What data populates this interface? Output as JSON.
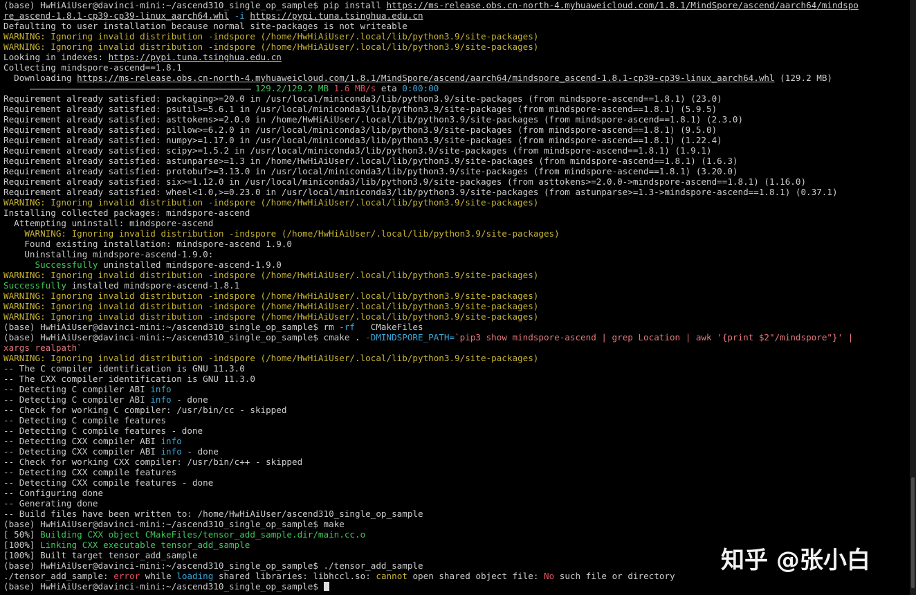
{
  "terminal": {
    "prompt": "(base) HwHiAiUser@davinci-mini:~/ascend310_single_op_sample$",
    "lines": [
      [
        {
          "t": "(base) HwHiAiUser@davinci-mini:~/ascend310_single_op_sample$ pip install ",
          "c": "default"
        },
        {
          "t": "https://ms-release.obs.cn-north-4.myhuaweicloud.com/1.8.1/MindSpore/ascend/aarch64/mindspo",
          "c": "default",
          "link": true
        }
      ],
      [
        {
          "t": "re_ascend-1.8.1-cp39-cp39-linux_aarch64.whl",
          "c": "default",
          "link": true
        },
        {
          "t": " ",
          "c": "default"
        },
        {
          "t": "-i",
          "c": "cyan"
        },
        {
          "t": " ",
          "c": "default"
        },
        {
          "t": "https://pypi.tuna.tsinghua.edu.cn",
          "c": "default",
          "link": true
        }
      ],
      [
        {
          "t": "Defaulting to user installation because normal site-packages is not writeable",
          "c": "default"
        }
      ],
      [
        {
          "t": "WARNING: Ignoring invalid distribution -indspore (/home/HwHiAiUser/.local/lib/python3.9/site-packages)",
          "c": "warn"
        }
      ],
      [
        {
          "t": "WARNING: Ignoring invalid distribution -indspore (/home/HwHiAiUser/.local/lib/python3.9/site-packages)",
          "c": "warn"
        }
      ],
      [
        {
          "t": "Looking in indexes: ",
          "c": "default"
        },
        {
          "t": "https://pypi.tuna.tsinghua.edu.cn",
          "c": "default",
          "link": true
        }
      ],
      [
        {
          "t": "Collecting mindspore-ascend==1.8.1",
          "c": "default"
        }
      ],
      [
        {
          "t": "  Downloading ",
          "c": "default"
        },
        {
          "t": "https://ms-release.obs.cn-north-4.myhuaweicloud.com/1.8.1/MindSpore/ascend/aarch64/mindspore_ascend-1.8.1-cp39-cp39-linux_aarch64.whl",
          "c": "default",
          "link": true
        },
        {
          "t": " (129.2 MB)",
          "c": "default"
        }
      ],
      [
        {
          "t": "     ",
          "c": "default"
        },
        {
          "bar": true
        },
        {
          "t": "129.2/129.2 MB",
          "c": "green"
        },
        {
          "t": " ",
          "c": "default"
        },
        {
          "t": "1.6 MB/s",
          "c": "red"
        },
        {
          "t": " eta ",
          "c": "default"
        },
        {
          "t": "0:00:00",
          "c": "cyan"
        }
      ],
      [
        {
          "t": "Requirement already satisfied: packaging>=20.0 in /usr/local/miniconda3/lib/python3.9/site-packages (from mindspore-ascend==1.8.1) (23.0)",
          "c": "default"
        }
      ],
      [
        {
          "t": "Requirement already satisfied: psutil>=5.6.1 in /usr/local/miniconda3/lib/python3.9/site-packages (from mindspore-ascend==1.8.1) (5.9.5)",
          "c": "default"
        }
      ],
      [
        {
          "t": "Requirement already satisfied: asttokens>=2.0.0 in /home/HwHiAiUser/.local/lib/python3.9/site-packages (from mindspore-ascend==1.8.1) (2.3.0)",
          "c": "default"
        }
      ],
      [
        {
          "t": "Requirement already satisfied: pillow>=6.2.0 in /usr/local/miniconda3/lib/python3.9/site-packages (from mindspore-ascend==1.8.1) (9.5.0)",
          "c": "default"
        }
      ],
      [
        {
          "t": "Requirement already satisfied: numpy>=1.17.0 in /usr/local/miniconda3/lib/python3.9/site-packages (from mindspore-ascend==1.8.1) (1.22.4)",
          "c": "default"
        }
      ],
      [
        {
          "t": "Requirement already satisfied: scipy>=1.5.2 in /usr/local/miniconda3/lib/python3.9/site-packages (from mindspore-ascend==1.8.1) (1.9.1)",
          "c": "default"
        }
      ],
      [
        {
          "t": "Requirement already satisfied: astunparse>=1.3 in /home/HwHiAiUser/.local/lib/python3.9/site-packages (from mindspore-ascend==1.8.1) (1.6.3)",
          "c": "default"
        }
      ],
      [
        {
          "t": "Requirement already satisfied: protobuf>=3.13.0 in /usr/local/miniconda3/lib/python3.9/site-packages (from mindspore-ascend==1.8.1) (3.20.0)",
          "c": "default"
        }
      ],
      [
        {
          "t": "Requirement already satisfied: six>=1.12.0 in /usr/local/miniconda3/lib/python3.9/site-packages (from asttokens>=2.0.0->mindspore-ascend==1.8.1) (1.16.0)",
          "c": "default"
        }
      ],
      [
        {
          "t": "Requirement already satisfied: wheel<1.0,>=0.23.0 in /usr/local/miniconda3/lib/python3.9/site-packages (from astunparse>=1.3->mindspore-ascend==1.8.1) (0.37.1)",
          "c": "default"
        }
      ],
      [
        {
          "t": "WARNING: Ignoring invalid distribution -indspore (/home/HwHiAiUser/.local/lib/python3.9/site-packages)",
          "c": "warn"
        }
      ],
      [
        {
          "t": "Installing collected packages: mindspore-ascend",
          "c": "default"
        }
      ],
      [
        {
          "t": "  Attempting uninstall: mindspore-ascend",
          "c": "default"
        }
      ],
      [
        {
          "t": "    WARNING: Ignoring invalid distribution -indspore (/home/HwHiAiUser/.local/lib/python3.9/site-packages)",
          "c": "warn"
        }
      ],
      [
        {
          "t": "    Found existing installation: mindspore-ascend 1.9.0",
          "c": "default"
        }
      ],
      [
        {
          "t": "    Uninstalling mindspore-ascend-1.9.0:",
          "c": "default"
        }
      ],
      [
        {
          "t": "      ",
          "c": "default"
        },
        {
          "t": "Successfully",
          "c": "green"
        },
        {
          "t": " uninstalled mindspore-ascend-1.9.0",
          "c": "default"
        }
      ],
      [
        {
          "t": "WARNING: Ignoring invalid distribution -indspore (/home/HwHiAiUser/.local/lib/python3.9/site-packages)",
          "c": "warn"
        }
      ],
      [
        {
          "t": "Successfully",
          "c": "green"
        },
        {
          "t": " installed mindspore-ascend-1.8.1",
          "c": "default"
        }
      ],
      [
        {
          "t": "WARNING: Ignoring invalid distribution -indspore (/home/HwHiAiUser/.local/lib/python3.9/site-packages)",
          "c": "warn"
        }
      ],
      [
        {
          "t": "WARNING: Ignoring invalid distribution -indspore (/home/HwHiAiUser/.local/lib/python3.9/site-packages)",
          "c": "warn"
        }
      ],
      [
        {
          "t": "WARNING: Ignoring invalid distribution -indspore (/home/HwHiAiUser/.local/lib/python3.9/site-packages)",
          "c": "warn"
        }
      ],
      [
        {
          "t": "(base) HwHiAiUser@davinci-mini:~/ascend310_single_op_sample$ rm ",
          "c": "default"
        },
        {
          "t": "-rf",
          "c": "cyan"
        },
        {
          "t": "   CMakeFiles",
          "c": "default"
        }
      ],
      [
        {
          "t": "(base) HwHiAiUser@davinci-mini:~/ascend310_single_op_sample$ cmake . ",
          "c": "default"
        },
        {
          "t": "-DMINDSPORE_PATH=",
          "c": "cyan"
        },
        {
          "t": "`pip3 show mindspore-ascend | grep Location | awk '{print $2\"/mindspore\"}' |",
          "c": "salmon"
        }
      ],
      [
        {
          "t": "xargs realpath`",
          "c": "salmon"
        }
      ],
      [
        {
          "t": "WARNING: Ignoring invalid distribution -indspore (/home/HwHiAiUser/.local/lib/python3.9/site-packages)",
          "c": "warn"
        }
      ],
      [
        {
          "t": "-- The C compiler identification is GNU 11.3.0",
          "c": "default"
        }
      ],
      [
        {
          "t": "-- The CXX compiler identification is GNU 11.3.0",
          "c": "default"
        }
      ],
      [
        {
          "t": "-- Detecting C compiler ABI ",
          "c": "default"
        },
        {
          "t": "info",
          "c": "cyan"
        }
      ],
      [
        {
          "t": "-- Detecting C compiler ABI ",
          "c": "default"
        },
        {
          "t": "info",
          "c": "cyan"
        },
        {
          "t": " - done",
          "c": "default"
        }
      ],
      [
        {
          "t": "-- Check for working C compiler: /usr/bin/cc - skipped",
          "c": "default"
        }
      ],
      [
        {
          "t": "-- Detecting C compile features",
          "c": "default"
        }
      ],
      [
        {
          "t": "-- Detecting C compile features - done",
          "c": "default"
        }
      ],
      [
        {
          "t": "-- Detecting CXX compiler ABI ",
          "c": "default"
        },
        {
          "t": "info",
          "c": "cyan"
        }
      ],
      [
        {
          "t": "-- Detecting CXX compiler ABI ",
          "c": "default"
        },
        {
          "t": "info",
          "c": "cyan"
        },
        {
          "t": " - done",
          "c": "default"
        }
      ],
      [
        {
          "t": "-- Check for working CXX compiler: /usr/bin/c++ - skipped",
          "c": "default"
        }
      ],
      [
        {
          "t": "-- Detecting CXX compile features",
          "c": "default"
        }
      ],
      [
        {
          "t": "-- Detecting CXX compile features - done",
          "c": "default"
        }
      ],
      [
        {
          "t": "-- Configuring done",
          "c": "default"
        }
      ],
      [
        {
          "t": "-- Generating done",
          "c": "default"
        }
      ],
      [
        {
          "t": "-- Build files have been written to: /home/HwHiAiUser/ascend310_single_op_sample",
          "c": "default"
        }
      ],
      [
        {
          "t": "(base) HwHiAiUser@davinci-mini:~/ascend310_single_op_sample$ make",
          "c": "default"
        }
      ],
      [
        {
          "t": "[ 50%] ",
          "c": "default"
        },
        {
          "t": "Building CXX object CMakeFiles/tensor_add_sample.dir/main.cc.o",
          "c": "green"
        }
      ],
      [
        {
          "t": "[100%] ",
          "c": "default"
        },
        {
          "t": "Linking CXX executable tensor_add_sample",
          "c": "green"
        }
      ],
      [
        {
          "t": "[100%] Built target tensor_add_sample",
          "c": "default"
        }
      ],
      [
        {
          "t": "(base) HwHiAiUser@davinci-mini:~/ascend310_single_op_sample$ ./tensor_add_sample",
          "c": "default"
        }
      ],
      [
        {
          "t": "./tensor_add_sample: ",
          "c": "default"
        },
        {
          "t": "error",
          "c": "red"
        },
        {
          "t": " while ",
          "c": "default"
        },
        {
          "t": "loading",
          "c": "cyan"
        },
        {
          "t": " shared libraries: libhccl.so: ",
          "c": "default"
        },
        {
          "t": "cannot",
          "c": "warn"
        },
        {
          "t": " open shared object file: ",
          "c": "default"
        },
        {
          "t": "No",
          "c": "red"
        },
        {
          "t": " such file or directory",
          "c": "default"
        }
      ],
      [
        {
          "t": "(base) HwHiAiUser@davinci-mini:~/ascend310_single_op_sample$ ",
          "c": "default"
        },
        {
          "cursor": true
        }
      ]
    ]
  },
  "progress": {
    "downloaded": 129.2,
    "total": 129.2,
    "fraction": 1.0
  },
  "watermark": {
    "text": "知乎 @张小白"
  },
  "colors": {
    "background": "#000000",
    "default_text": "#cccccc",
    "warning": "#c8b434",
    "success": "#3fc65a",
    "option": "#3aa6d8",
    "error": "#e0505f",
    "command_substitution": "#e5787c"
  }
}
